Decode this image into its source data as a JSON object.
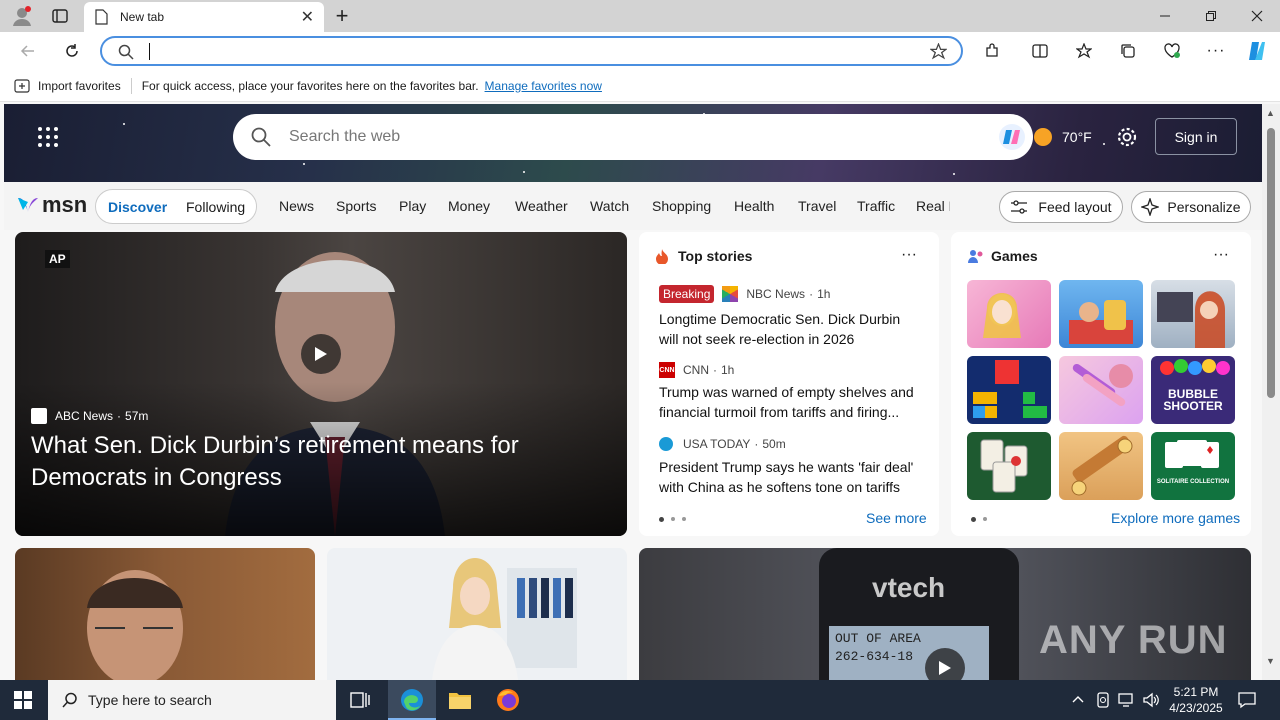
{
  "browser": {
    "tab_title": "New tab",
    "favorites": {
      "import_label": "Import favorites",
      "hint": "For quick access, place your favorites here on the favorites bar.",
      "manage_link": "Manage favorites now"
    }
  },
  "msn": {
    "search_placeholder": "Search the web",
    "temperature": "70°F",
    "sign_in": "Sign in",
    "logo": "msn",
    "tabs": [
      "Discover",
      "Following"
    ],
    "nav": [
      "News",
      "Sports",
      "Play",
      "Money",
      "Weather",
      "Watch",
      "Shopping",
      "Health",
      "Travel",
      "Traffic",
      "Real E"
    ],
    "feed_layout": "Feed layout",
    "personalize": "Personalize"
  },
  "hero_story": {
    "badge": "AP",
    "source": "ABC News",
    "age": "57m",
    "title": "What Sen. Dick Durbin’s retirement means for Democrats in Congress"
  },
  "top_stories": {
    "title": "Top stories",
    "items": [
      {
        "badge": "Breaking",
        "source": "NBC News",
        "age": "1h",
        "title": "Longtime Democratic Sen. Dick Durbin will not seek re-election in 2026"
      },
      {
        "source": "CNN",
        "age": "1h",
        "title": "Trump was warned of empty shelves and financial turmoil from tariffs and firing..."
      },
      {
        "source": "USA TODAY",
        "age": "50m",
        "title": "President Trump says he wants 'fair deal' with China as he softens tone on tariffs"
      }
    ],
    "see_more": "See more"
  },
  "games": {
    "title": "Games",
    "explore": "Explore more games",
    "bubble_label": "BUBBLE SHOOTER",
    "solitaire_label": "SOLITAIRE COLLECTION"
  },
  "video_card": {
    "brand": "vtech",
    "screen_line1": "OUT OF AREA",
    "screen_line2": "262-634-18"
  },
  "watermark": "ANY RUN",
  "taskbar": {
    "search_placeholder": "Type here to search",
    "time": "5:21 PM",
    "date": "4/23/2025"
  }
}
